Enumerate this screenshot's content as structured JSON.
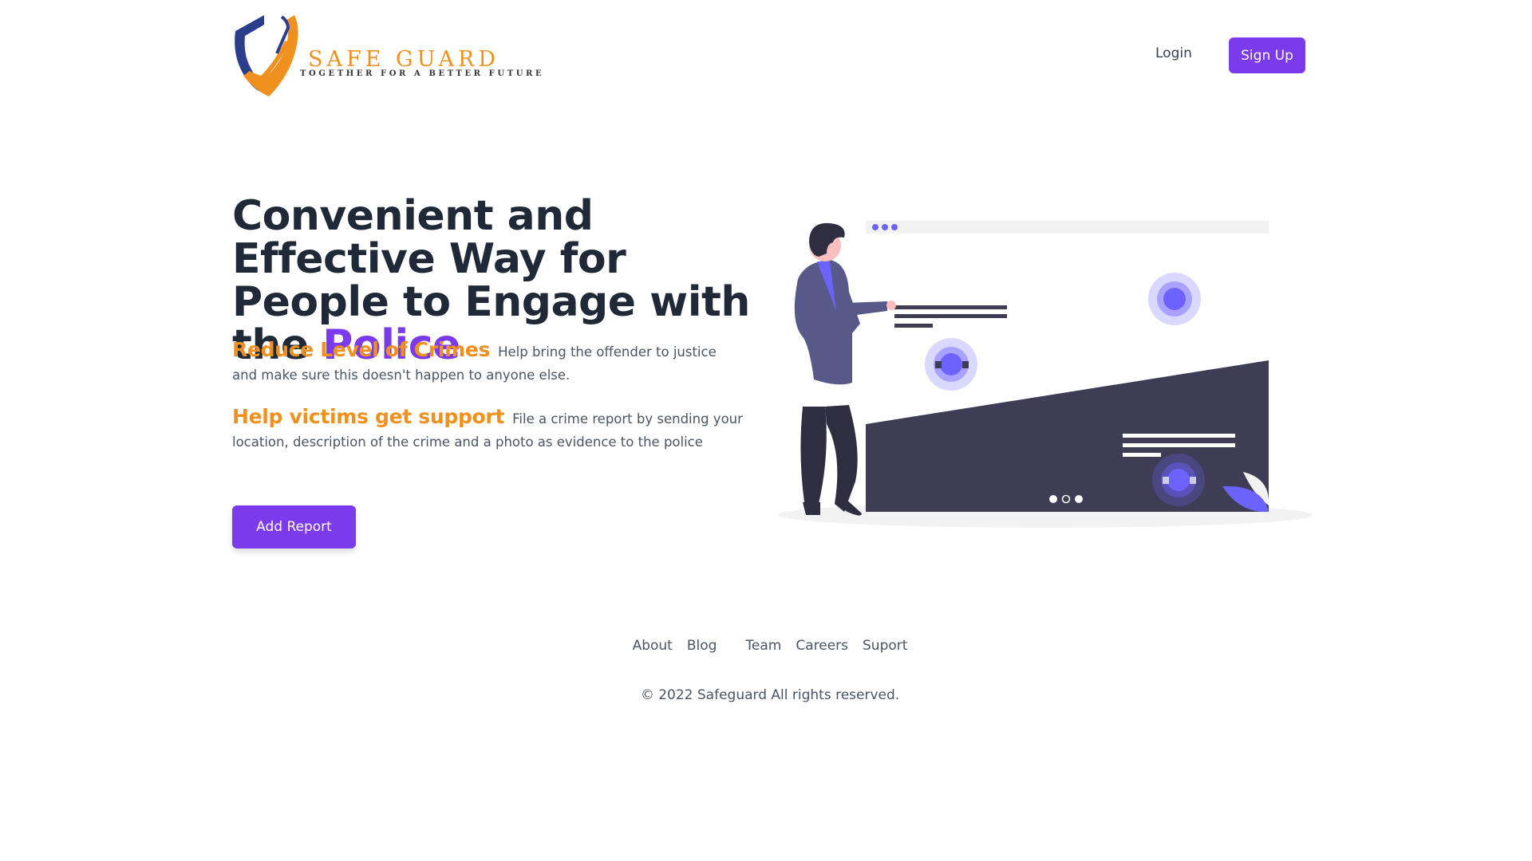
{
  "brand": {
    "name": "SAFE GUARD",
    "tagline": "TOGETHER FOR A BETTER FUTURE",
    "colors": {
      "orange": "#f0911f",
      "navy": "#2b3e8c"
    }
  },
  "header": {
    "login_label": "Login",
    "signup_label": "Sign Up"
  },
  "hero": {
    "title_main": "Convenient and Effective Way for People to Engage with the ",
    "title_accent": "Police",
    "features": [
      {
        "heading": "Reduce Level of Crimes",
        "text": "Help bring the offender to justice and make sure this doesn't happen to anyone else."
      },
      {
        "heading": "Help victims get support",
        "text": "File a crime report by sending your location, description of the crime and a photo as evidence to the police"
      }
    ],
    "cta_label": "Add Report"
  },
  "footer": {
    "links": [
      "About",
      "Blog",
      "Team",
      "Careers",
      "Suport"
    ],
    "copyright": "© 2022 Safeguard All rights reserved."
  },
  "colors": {
    "accent": "#7c3aed",
    "heading": "#1f2937",
    "highlight": "#f0911f",
    "illustration_dark": "#3f3d56"
  }
}
